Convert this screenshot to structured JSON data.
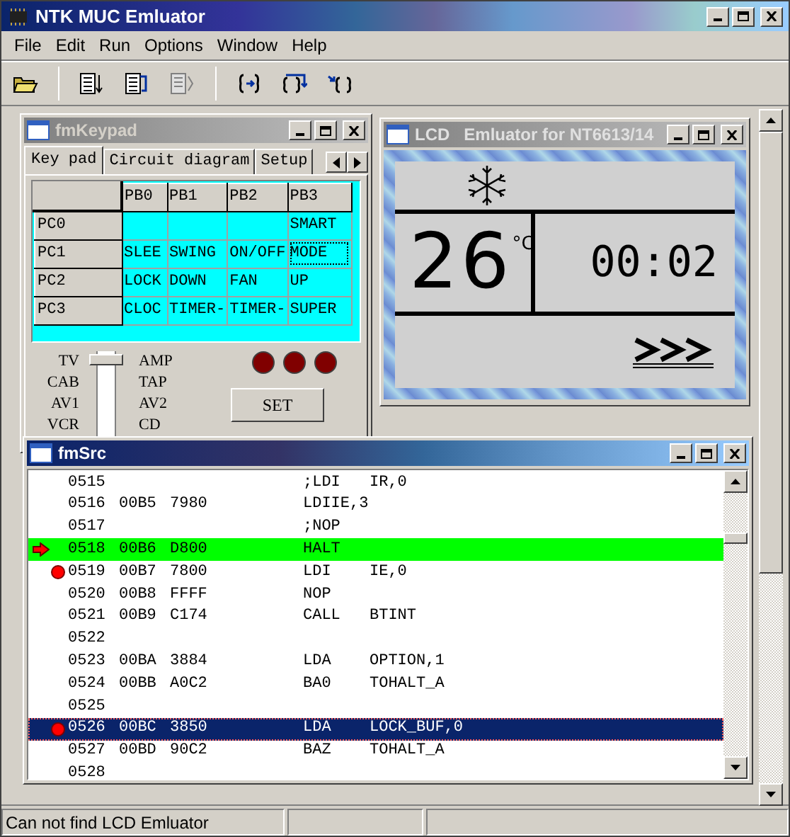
{
  "window": {
    "title": "NTK MUC Emluator"
  },
  "menu": [
    "File",
    "Edit",
    "Run",
    "Options",
    "Window",
    "Help"
  ],
  "keypad_window": {
    "title": "fmKeypad",
    "active": false,
    "tabs": [
      {
        "label": "Key pad",
        "selected": true
      },
      {
        "label": "Circuit diagram",
        "selected": false
      },
      {
        "label": "Setup",
        "selected": false
      }
    ],
    "grid": {
      "columns": [
        "PB0",
        "PB1",
        "PB2",
        "PB3"
      ],
      "rows": [
        {
          "label": "PC0",
          "cells": [
            {
              "focused": false
            },
            {
              "focused": false
            },
            {
              "focused": false
            },
            {
              "text": "SMART",
              "focused": false
            }
          ]
        },
        {
          "label": "PC1",
          "cells": [
            {
              "text": "SLEE",
              "focused": false
            },
            {
              "text": "SWING",
              "focused": false
            },
            {
              "text": "ON/OFF",
              "focused": false
            },
            {
              "text": "MODE",
              "focused": true
            }
          ]
        },
        {
          "label": "PC2",
          "cells": [
            {
              "text": "LOCK",
              "focused": false
            },
            {
              "text": "DOWN",
              "focused": false
            },
            {
              "text": "FAN",
              "focused": false
            },
            {
              "text": "UP",
              "focused": false
            }
          ]
        },
        {
          "label": "PC3",
          "cells": [
            {
              "text": "CLOC",
              "focused": false
            },
            {
              "text": "TIMER-",
              "focused": false
            },
            {
              "text": "TIMER-",
              "focused": false
            },
            {
              "text": "SUPER",
              "focused": false
            }
          ]
        }
      ]
    },
    "slider": {
      "positions": [
        {
          "left": "TV",
          "right": "AMP",
          "selected": true
        },
        {
          "left": "CAB",
          "right": "TAP",
          "selected": false
        },
        {
          "left": "AV1",
          "right": "AV2",
          "selected": false
        },
        {
          "left": "VCR",
          "right": "CD",
          "selected": false
        }
      ]
    },
    "leds": [
      {
        "on": false
      },
      {
        "on": false
      },
      {
        "on": false
      }
    ],
    "set_button": "SET"
  },
  "lcd_window": {
    "title": "LCD   Emluator for NT6613/14",
    "active": false,
    "temperature": "26",
    "unit": "°C",
    "time": "00:02"
  },
  "source_window": {
    "title": "fmSrc",
    "active": true,
    "rows": [
      {
        "line": "0515",
        "code": ";LDI",
        "operand": "IR,0",
        "current": false,
        "selected": false,
        "breakpoint": false
      },
      {
        "line": "0516",
        "address": "00B5",
        "opcode": "7980",
        "code": "LDIIE,3",
        "current": false,
        "selected": false,
        "breakpoint": false
      },
      {
        "line": "0517",
        "code": ";NOP",
        "current": false,
        "selected": false,
        "breakpoint": false
      },
      {
        "line": "0518",
        "address": "00B6",
        "opcode": "D800",
        "code": "HALT",
        "current": true,
        "selected": false,
        "breakpoint": false
      },
      {
        "line": "0519",
        "address": "00B7",
        "opcode": "7800",
        "code": "LDI",
        "operand": "IE,0",
        "current": false,
        "selected": false,
        "breakpoint": true
      },
      {
        "line": "0520",
        "address": "00B8",
        "opcode": "FFFF",
        "code": "NOP",
        "current": false,
        "selected": false,
        "breakpoint": false
      },
      {
        "line": "0521",
        "address": "00B9",
        "opcode": "C174",
        "code": "CALL",
        "operand": "BTINT",
        "current": false,
        "selected": false,
        "breakpoint": false
      },
      {
        "line": "0522",
        "current": false,
        "selected": false,
        "breakpoint": false
      },
      {
        "line": "0523",
        "address": "00BA",
        "opcode": "3884",
        "code": "LDA",
        "operand": "OPTION,1",
        "current": false,
        "selected": false,
        "breakpoint": false
      },
      {
        "line": "0524",
        "address": "00BB",
        "opcode": "A0C2",
        "code": "BA0",
        "operand": "TOHALT_A",
        "current": false,
        "selected": false,
        "breakpoint": false
      },
      {
        "line": "0525",
        "current": false,
        "selected": false,
        "breakpoint": false
      },
      {
        "line": "0526",
        "address": "00BC",
        "opcode": "3850",
        "code": "LDA",
        "operand": "LOCK_BUF,0",
        "current": false,
        "selected": true,
        "breakpoint": true
      },
      {
        "line": "0527",
        "address": "00BD",
        "opcode": "90C2",
        "code": "BAZ",
        "operand": "TOHALT_A",
        "current": false,
        "selected": false,
        "breakpoint": false
      },
      {
        "line": "0528",
        "current": false,
        "selected": false,
        "breakpoint": false
      }
    ]
  },
  "status_bar": [
    "Can not find LCD Emluator"
  ]
}
